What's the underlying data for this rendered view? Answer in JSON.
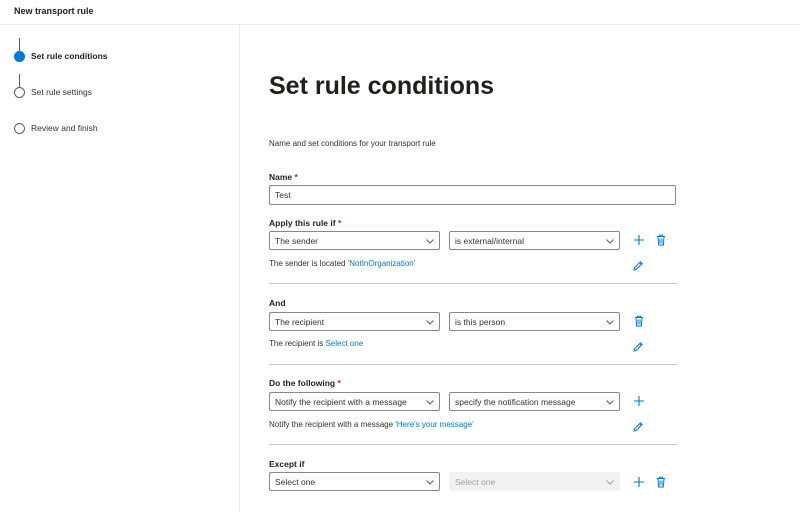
{
  "window": {
    "title": "New transport rule"
  },
  "steps": [
    {
      "label": "Set rule conditions",
      "active": true
    },
    {
      "label": "Set rule settings",
      "active": false
    },
    {
      "label": "Review and finish",
      "active": false
    }
  ],
  "main": {
    "heading": "Set rule conditions",
    "subtext": "Name and set conditions for your transport rule",
    "name": {
      "label": "Name",
      "required_mark": "*",
      "value": "Test"
    },
    "apply_if": {
      "label": "Apply this rule if",
      "required_mark": "*",
      "select1": "The sender",
      "select2": "is external/internal",
      "info_prefix": "The sender is located ",
      "info_link": "'NotInOrganization'"
    },
    "and": {
      "label": "And",
      "select1": "The recipient",
      "select2": "is this person",
      "info_prefix": "The recipient is ",
      "info_link": "Select one"
    },
    "do_following": {
      "label": "Do the following",
      "required_mark": "*",
      "select1": "Notify the recipient with a message",
      "select2": "specify the notification message",
      "info_prefix": "Notify the recipient with a message ",
      "info_link": "'Here's your message'"
    },
    "except_if": {
      "label": "Except if",
      "select1": "Select one",
      "select2": "Select one"
    }
  },
  "icons": [
    "add-icon",
    "delete-icon",
    "edit-icon",
    "chevron-down-icon"
  ],
  "colors": {
    "accent": "#0078d4",
    "required": "#a4262c",
    "border": "#8a8886"
  }
}
